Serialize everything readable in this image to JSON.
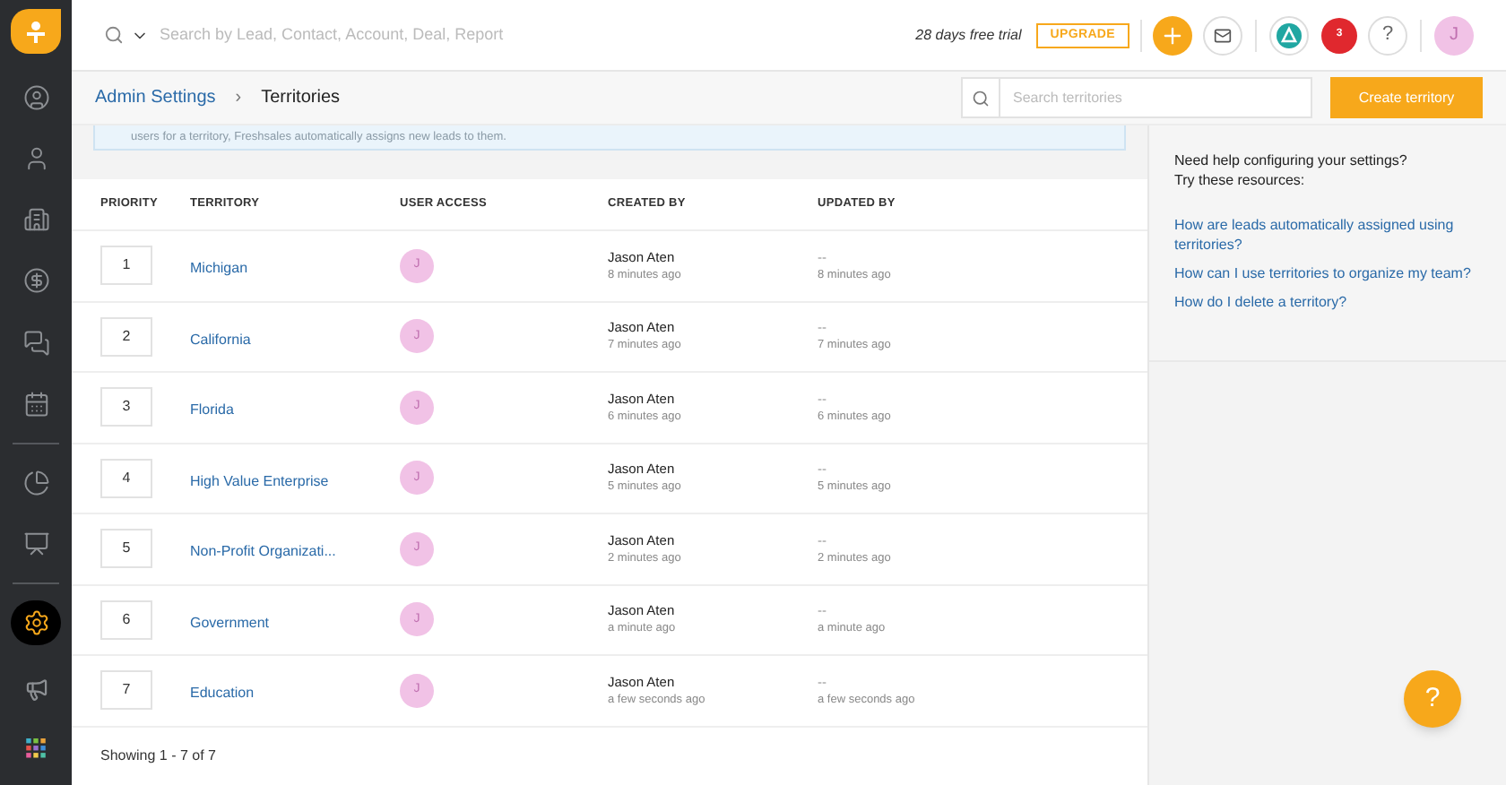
{
  "sidebar": {
    "items": [
      {
        "kind": "contact",
        "selected": false
      },
      {
        "kind": "account",
        "selected": false
      },
      {
        "kind": "company",
        "selected": false
      },
      {
        "kind": "deal",
        "selected": false
      },
      {
        "kind": "chat",
        "selected": false
      },
      {
        "kind": "calendar",
        "selected": false
      },
      {
        "kind": "pie",
        "selected": false
      },
      {
        "kind": "report",
        "selected": false
      },
      {
        "kind": "settings",
        "selected": true
      }
    ]
  },
  "topbar": {
    "search_placeholder": "Search by Lead, Contact, Account, Deal, Report",
    "trial": "28 days free trial",
    "upgrade": "UPGRADE",
    "notifications": "3",
    "help": "?",
    "avatar": "J"
  },
  "breadcrumb": {
    "parent": "Admin Settings",
    "separator": "›",
    "current": "Territories"
  },
  "toolbar": {
    "search_placeholder": "Search territories",
    "create": "Create territory"
  },
  "banner": "users for a territory, Freshsales automatically assigns new leads to them.",
  "table": {
    "columns": [
      "PRIORITY",
      "TERRITORY",
      "USER ACCESS",
      "CREATED BY",
      "UPDATED BY"
    ],
    "rows": [
      {
        "priority": "1",
        "territory": "Michigan",
        "user": "J",
        "created_by": "Jason Aten",
        "created_ago": "8 minutes ago",
        "updated_by": "--",
        "updated_ago": "8 minutes ago"
      },
      {
        "priority": "2",
        "territory": "California",
        "user": "J",
        "created_by": "Jason Aten",
        "created_ago": "7 minutes ago",
        "updated_by": "--",
        "updated_ago": "7 minutes ago"
      },
      {
        "priority": "3",
        "territory": "Florida",
        "user": "J",
        "created_by": "Jason Aten",
        "created_ago": "6 minutes ago",
        "updated_by": "--",
        "updated_ago": "6 minutes ago"
      },
      {
        "priority": "4",
        "territory": "High Value Enterprise",
        "user": "J",
        "created_by": "Jason Aten",
        "created_ago": "5 minutes ago",
        "updated_by": "--",
        "updated_ago": "5 minutes ago"
      },
      {
        "priority": "5",
        "territory": "Non-Profit Organizati...",
        "user": "J",
        "created_by": "Jason Aten",
        "created_ago": "2 minutes ago",
        "updated_by": "--",
        "updated_ago": "2 minutes ago"
      },
      {
        "priority": "6",
        "territory": "Government",
        "user": "J",
        "created_by": "Jason Aten",
        "created_ago": "a minute ago",
        "updated_by": "--",
        "updated_ago": "a minute ago"
      },
      {
        "priority": "7",
        "territory": "Education",
        "user": "J",
        "created_by": "Jason Aten",
        "created_ago": "a few seconds ago",
        "updated_by": "--",
        "updated_ago": "a few seconds ago"
      }
    ],
    "footer": "Showing 1 - 7 of 7"
  },
  "help_panel": {
    "intro": "Need help configuring your settings?",
    "intro2": "Try these resources:",
    "links": [
      "How are leads automatically assigned using territories?",
      "How can I use territories to organize my team?",
      "How do I delete a territory?"
    ],
    "fab": "?"
  }
}
